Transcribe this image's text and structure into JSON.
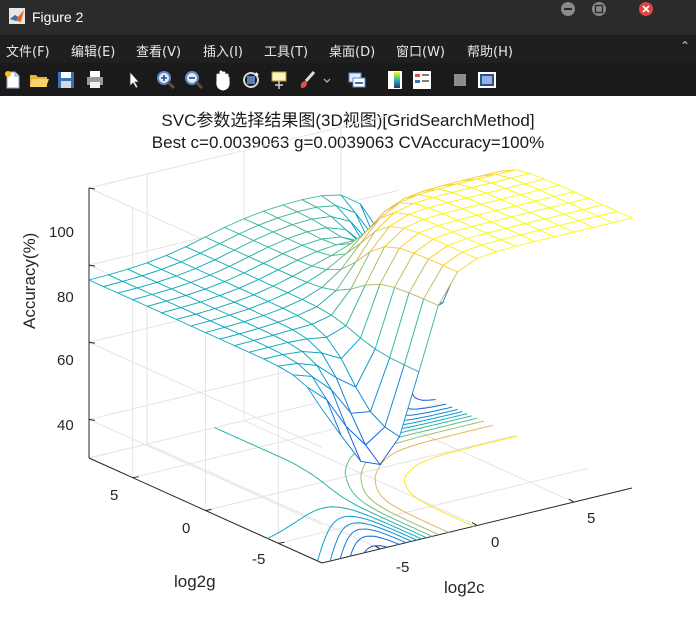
{
  "window": {
    "title": "Figure 2"
  },
  "menu": [
    "文件(F)",
    "编辑(E)",
    "查看(V)",
    "插入(I)",
    "工具(T)",
    "桌面(D)",
    "窗口(W)",
    "帮助(H)"
  ],
  "toolbar_icons": [
    "new-figure-icon",
    "open-icon",
    "save-icon",
    "print-icon",
    "pointer-icon",
    "zoom-in-icon",
    "zoom-out-icon",
    "pan-icon",
    "rotate-3d-icon",
    "data-cursor-icon",
    "brush-icon",
    "link-plot-icon",
    "colorbar-icon",
    "legend-icon",
    "hide-plot-tools-icon",
    "show-plot-tools-icon"
  ],
  "plot": {
    "title_line1": "SVC参数选择结果图(3D视图)[GridSearchMethod]",
    "title_line2": "Best c=0.0039063 g=0.0039063 CVAccuracy=100%",
    "zlabel": "Accuracy(%)",
    "xlabel": "log2c",
    "ylabel": "log2g",
    "ztick_labels": [
      "40",
      "60",
      "80",
      "100"
    ],
    "xtick_labels": [
      "-5",
      "0",
      "5"
    ],
    "ytick_labels": [
      "-5",
      "0",
      "5"
    ]
  },
  "chart_data": {
    "type": "surface",
    "x_name": "log2c",
    "y_name": "log2g",
    "z_name": "Accuracy(%)",
    "xlim": [
      -8,
      8
    ],
    "ylim": [
      -8,
      8
    ],
    "zlim": [
      30,
      100
    ],
    "x_step": 1,
    "y_step": 1,
    "grid": true,
    "colormap": "parula",
    "contour_projection": true,
    "surface_shape": {
      "plateau_value": 100,
      "low_value": 47,
      "note": "accuracy ~100 for log2g below about 2 and log2c above about -4; drops toward ~47 at high log2g and low log2c"
    }
  }
}
